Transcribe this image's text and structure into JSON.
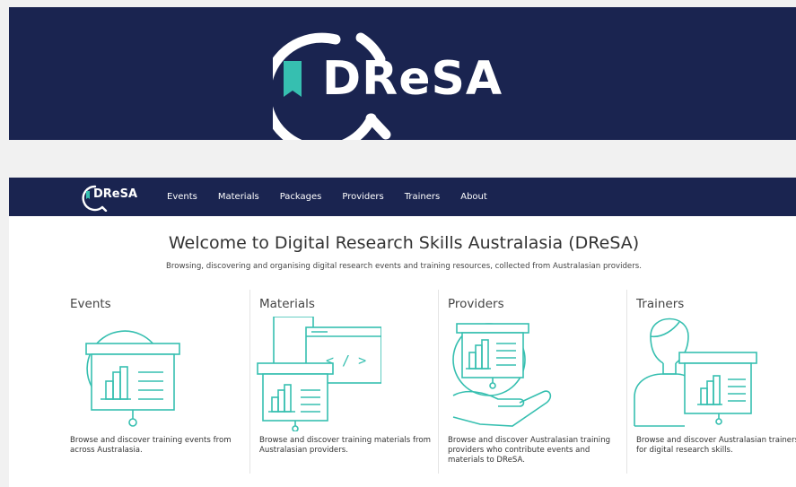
{
  "banner": {
    "logo_text": "DReSA"
  },
  "navbar": {
    "logo_text": "DReSA",
    "links": [
      "Events",
      "Materials",
      "Packages",
      "Providers",
      "Trainers",
      "About"
    ]
  },
  "hero": {
    "title": "Welcome to Digital Research Skills Australasia (DReSA)",
    "subtitle": "Browsing, discovering and organising digital research events and training resources, collected from Australasian providers."
  },
  "sections": [
    {
      "title": "Events",
      "icon": "events-illustration-icon",
      "description": "Browse and discover training events from across Australasia."
    },
    {
      "title": "Materials",
      "icon": "materials-illustration-icon",
      "description": "Browse and discover training materials from Australasian providers."
    },
    {
      "title": "Providers",
      "icon": "providers-illustration-icon",
      "description": "Browse and discover Australasian training providers who contribute events and materials to DReSA."
    },
    {
      "title": "Trainers",
      "icon": "trainers-illustration-icon",
      "description": "Browse and discover Australasian trainers for digital research skills."
    }
  ],
  "colors": {
    "navy": "#1a2450",
    "teal": "#36bfb0",
    "white": "#ffffff"
  }
}
